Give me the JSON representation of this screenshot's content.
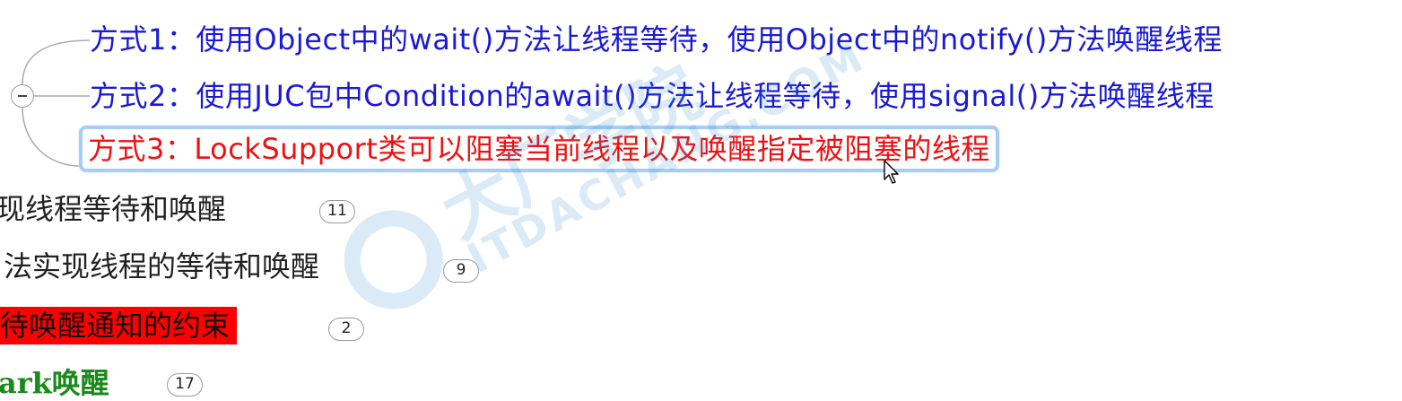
{
  "mindmap": {
    "nodes": [
      {
        "label": "方式1：使用Object中的wait()方法让线程等待，使用Object中的notify()方法唤醒线程"
      },
      {
        "label": "方式2：使用JUC包中Condition的await()方法让线程等待，使用signal()方法唤醒线程"
      },
      {
        "label": "方式3：LockSupport类可以阻塞当前线程以及唤醒指定被阻塞的线程"
      }
    ],
    "children": [
      {
        "label": "现线程等待和唤醒",
        "count": "11"
      },
      {
        "label": "法实现线程的等待和唤醒",
        "count": "9"
      },
      {
        "label": "待唤醒通知的约束",
        "count": "2"
      },
      {
        "label": "ark唤醒",
        "count": "17"
      }
    ]
  },
  "watermark": {
    "line1": "大厂学院",
    "line2": "ITDACHANG.COM"
  },
  "colors": {
    "node_blue": "#1a1ad6",
    "node_red": "#ee1111",
    "selection_border": "#a8cdf3",
    "highlight_bg": "#ff0000",
    "green_text": "#1a8a1a"
  },
  "icons": {
    "collapse": "minus-circle-icon",
    "cursor": "arrow-cursor-icon"
  }
}
